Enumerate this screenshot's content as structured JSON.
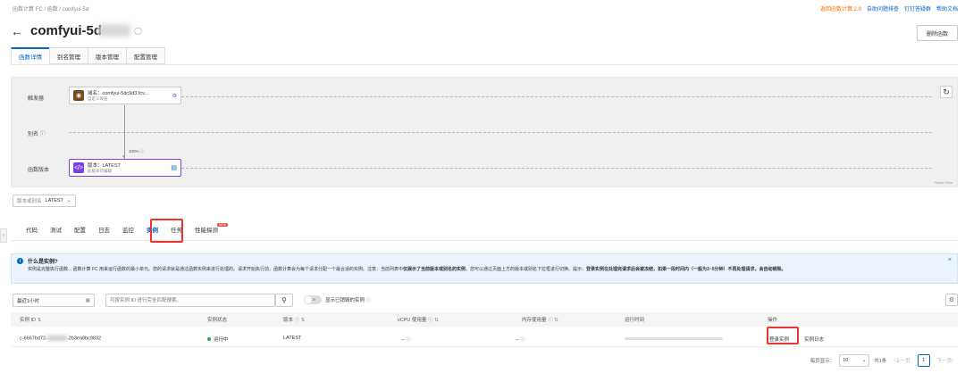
{
  "breadcrumb": {
    "root": "函数计算 FC",
    "sep": "/",
    "level2": "函数",
    "level3": "comfyui-5d"
  },
  "top_links": {
    "back_v2": "返回函数计算 2.0",
    "self_check": "自助问题排查",
    "dingtalk": "钉钉答疑群",
    "help": "帮助文档"
  },
  "page": {
    "back_icon": "←",
    "title": "comfyui-5d",
    "delete_label": "删除函数"
  },
  "top_tabs": [
    {
      "label": "函数详情",
      "active": true
    },
    {
      "label": "别名管理",
      "active": false
    },
    {
      "label": "版本管理",
      "active": false
    },
    {
      "label": "配置管理",
      "active": false
    }
  ],
  "flow": {
    "rows": {
      "trigger": "触发器",
      "alias": "别名",
      "version": "函数版本"
    },
    "trigger_node": {
      "title": "域名：comfyui-5dc9d3.fcv...",
      "sub": "自定义域名"
    },
    "edge_label": "100%",
    "version_node": {
      "title": "版本：LATEST",
      "sub": "此版本可编辑"
    },
    "watermark": "React Flow"
  },
  "version_select": {
    "label": "版本或别名",
    "value": "LATEST"
  },
  "sub_tabs": [
    {
      "label": "代码",
      "active": false
    },
    {
      "label": "测试",
      "active": false
    },
    {
      "label": "配置",
      "active": false
    },
    {
      "label": "日志",
      "active": false
    },
    {
      "label": "监控",
      "active": false
    },
    {
      "label": "实例",
      "active": true
    },
    {
      "label": "任务",
      "active": false
    },
    {
      "label": "性能探测",
      "active": false,
      "badge": "NEW"
    }
  ],
  "info": {
    "title": "什么是实例?",
    "body_1": "实例是完整执行函数... 函数计算 FC 用来运行函数的最小单元。您的请求就是通过函数实例来进行处理的。请求开始执行前，函数计算会为每个请求分配一个最合适的实例。注意：当前列表中",
    "body_bold_1": "仅展示了当前版本或别名的实例",
    "body_2": "，您可以通过页面上方的版本或别名下拉框进行切换。提示：",
    "body_bold_2": "登录实例在处理完请求后会被冻结，如果一段时间内（一般为3~5分钟）不再处理请求，会自动销毁。"
  },
  "filters": {
    "time_value": "最近1小时",
    "search_placeholder": "可按实例 ID 进行完全匹配搜索。",
    "toggle_text": "Off",
    "toggle_label": "显示已销毁的实例"
  },
  "table": {
    "headers": [
      "实例 ID",
      "实例状态",
      "版本",
      "vCPU 使用量",
      "内存使用量",
      "运行时间",
      "操作"
    ],
    "rows": [
      {
        "id_prefix": "c-6667bd72-",
        "id_suffix": "-2b3ea8bc9832",
        "status": "运行中",
        "version": "LATEST",
        "vcpu": "--",
        "memory": "--",
        "login": "登录实例",
        "logs": "实例日志"
      }
    ]
  },
  "pager": {
    "per_page_label": "每页显示：",
    "per_page": "10",
    "total": "共1条",
    "prev": "上一页",
    "current": "1",
    "next": "下一页"
  }
}
